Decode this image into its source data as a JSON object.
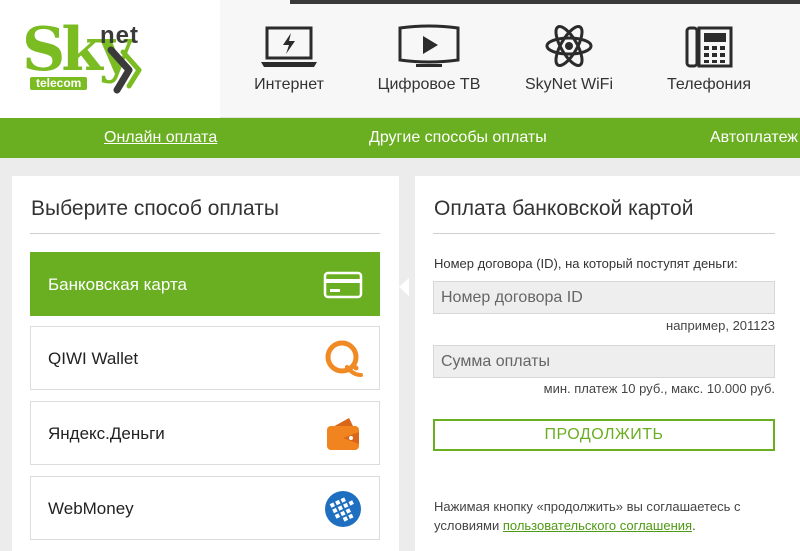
{
  "logo": {
    "sky": "Sky",
    "net": "net",
    "telecom": "telecom"
  },
  "nav": [
    {
      "label": "Интернет",
      "icon": "laptop-bolt-icon"
    },
    {
      "label": "Цифровое ТВ",
      "icon": "tv-play-icon"
    },
    {
      "label": "SkyNet WiFi",
      "icon": "wifi-atom-icon"
    },
    {
      "label": "Телефония",
      "icon": "desk-phone-icon"
    }
  ],
  "subnav": [
    {
      "label": "Онлайн оплата",
      "active": true
    },
    {
      "label": "Другие способы оплаты",
      "active": false
    },
    {
      "label": "Автоплатеж",
      "active": false
    }
  ],
  "methods_panel": {
    "title": "Выберите способ оплаты",
    "methods": [
      {
        "label": "Банковская карта",
        "icon": "credit-card-icon",
        "active": true
      },
      {
        "label": "QIWI Wallet",
        "icon": "qiwi-icon",
        "active": false
      },
      {
        "label": "Яндекс.Деньги",
        "icon": "yandex-money-icon",
        "active": false
      },
      {
        "label": "WebMoney",
        "icon": "webmoney-icon",
        "active": false
      }
    ]
  },
  "form": {
    "title": "Оплата банковской картой",
    "contract_label": "Номер договора (ID), на который поступят деньги:",
    "contract_placeholder": "Номер договора ID",
    "contract_hint": "например, 201123",
    "amount_placeholder": "Сумма оплаты",
    "amount_hint": "мин. платеж 10 руб., макс. 10.000 руб.",
    "submit_label": "ПРОДОЛЖИТЬ",
    "terms_text": "Нажимая кнопку «продолжить» вы соглашаетесь с условиями ",
    "terms_link": "пользовательского соглашения",
    "terms_end": "."
  },
  "colors": {
    "brand_green": "#6aaf21",
    "logo_green": "#7cbc23",
    "qiwi_orange": "#f08a24",
    "yandex_orange": "#f2841f",
    "webmoney_blue": "#1f6fc1"
  }
}
